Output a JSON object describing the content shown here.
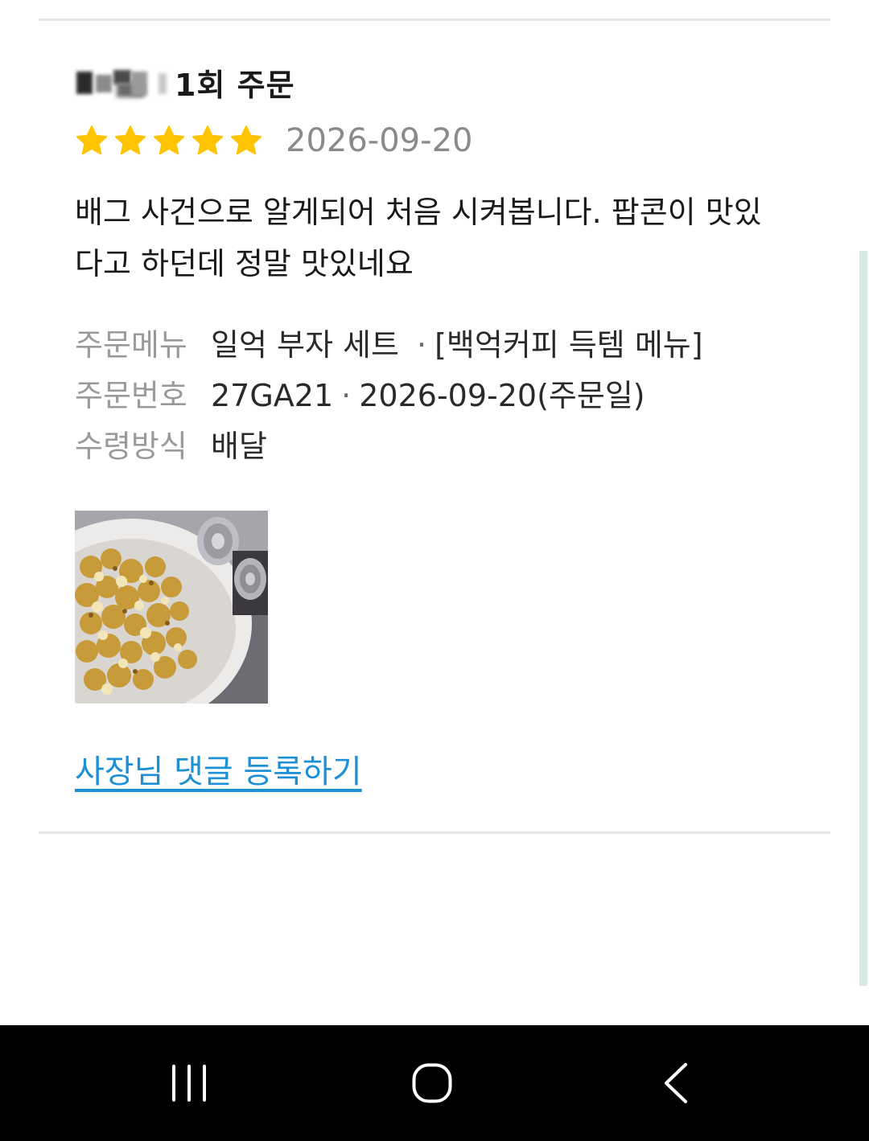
{
  "review": {
    "reviewer_name_blurred": true,
    "order_count": "1회 주문",
    "rating": 5,
    "rating_max": 5,
    "date": "2026-09-20",
    "text": "배그 사건으로 알게되어 처음 시켜봅니다. 팝콘이 맛있다고 하던데 정말 맛있네요",
    "info": {
      "menu_label": "주문메뉴",
      "menu_value": "일억 부자 세트 ",
      "menu_separator": "·",
      "menu_category": "[백억커피 득템 메뉴]",
      "order_no_label": "주문번호",
      "order_no_value": "27GA21",
      "order_separator": "·",
      "order_date": "2026-09-20(주문일)",
      "method_label": "수령방식",
      "method_value": "배달"
    },
    "photo": "popcorn-bowl-with-cans",
    "reply_link": "사장님 댓글 등록하기"
  },
  "colors": {
    "star": "#FFC400",
    "link": "#1E90D6",
    "muted_text": "#9A9A9A",
    "date_text": "#8A8A8A",
    "scroll_indicator": "#D7EBE1",
    "navbar": "#000000"
  },
  "navbar": {
    "recents_icon": "recent-apps-icon",
    "home_icon": "home-icon",
    "back_icon": "back-icon"
  }
}
